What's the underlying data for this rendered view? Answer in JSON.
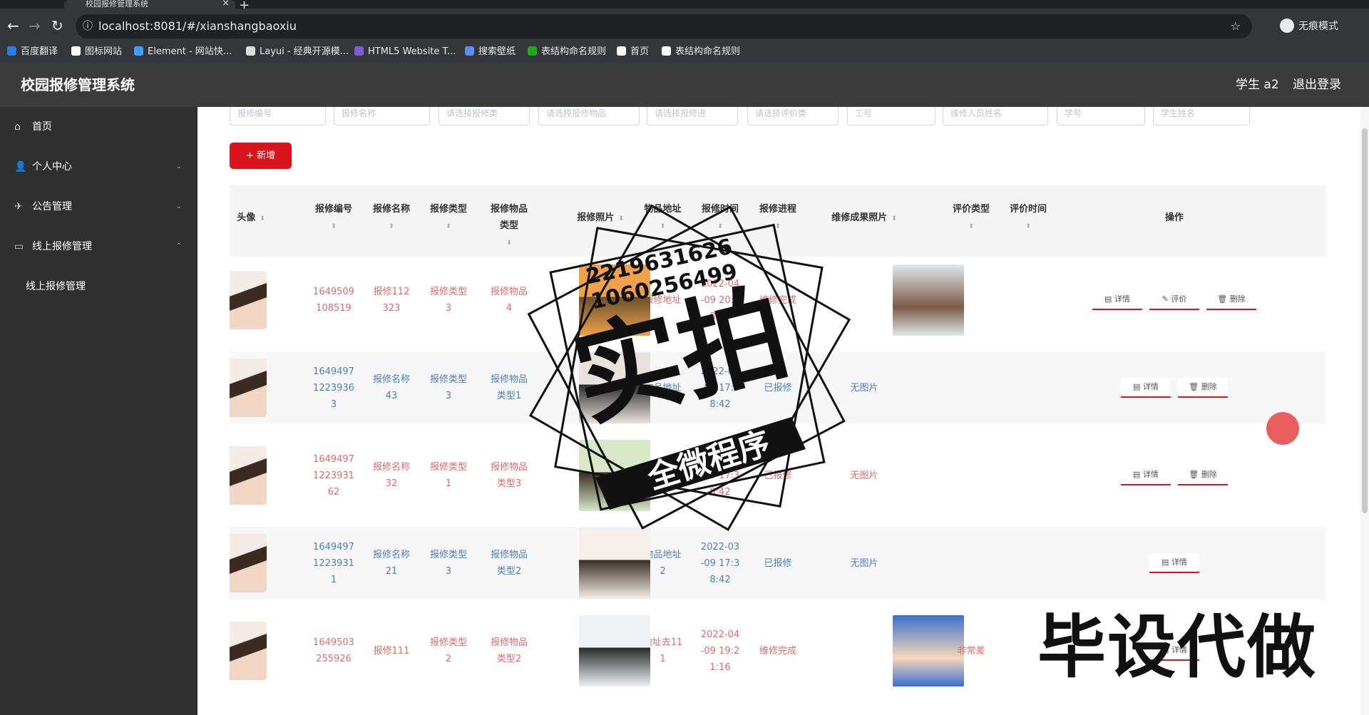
{
  "browser": {
    "tab_title": "校园报修管理系统",
    "tab_close": "×",
    "new_tab": "+",
    "back": "←",
    "forward": "→",
    "reload": "↻",
    "info_icon": "ⓘ",
    "url": "localhost:8081/#/xianshangbaoxiu",
    "star": "☆",
    "incognito_label": "无痕模式",
    "bookmarks": [
      {
        "label": "百度翻译",
        "color": "#2d7be5"
      },
      {
        "label": "图标网站",
        "color": "#ffffff"
      },
      {
        "label": "Element - 网站快...",
        "color": "#409eff"
      },
      {
        "label": "Layui - 经典开源模...",
        "color": "#dddddd"
      },
      {
        "label": "HTML5 Website T...",
        "color": "#7b5cd6"
      },
      {
        "label": "搜索壁纸",
        "color": "#5b8def"
      },
      {
        "label": "表结构命名规则",
        "color": "#1aad19"
      },
      {
        "label": "首页",
        "color": "#ffffff"
      },
      {
        "label": "表结构命名规则",
        "color": "#ffffff"
      }
    ]
  },
  "header": {
    "title": "校园报修管理系统",
    "user": "学生 a2",
    "logout": "退出登录"
  },
  "sidebar": {
    "items": [
      {
        "label": "首页",
        "icon": "⌂",
        "arrow": ""
      },
      {
        "label": "个人中心",
        "icon": "👤",
        "arrow": "⌄"
      },
      {
        "label": "公告管理",
        "icon": "✈",
        "arrow": "⌄"
      },
      {
        "label": "线上报修管理",
        "icon": "▭",
        "arrow": "⌃"
      }
    ],
    "subitem": "线上报修管理"
  },
  "search": {
    "fields": [
      "报修编号",
      "报修名称",
      "请选择报修类",
      "请选择报修物品",
      "请选择报修进",
      "请选择评价类",
      "工号",
      "维修人员姓名",
      "学号",
      "学生姓名"
    ]
  },
  "add_button": "+ 新增",
  "table": {
    "sort_glyph": "⬍",
    "columns": [
      {
        "l1": "头像",
        "l2": "",
        "sort_inline": true
      },
      {
        "l1": "报修编号",
        "l2": "",
        "sort_inline": false
      },
      {
        "l1": "报修名称",
        "l2": "",
        "sort_inline": false
      },
      {
        "l1": "报修类型",
        "l2": "",
        "sort_inline": false
      },
      {
        "l1": "报修物品",
        "l2": "类型",
        "sort_inline": false
      },
      {
        "l1": "报修照片",
        "l2": "",
        "sort_inline": true
      },
      {
        "l1": "物品地址",
        "l2": "",
        "sort_inline": false
      },
      {
        "l1": "报修时间",
        "l2": "",
        "sort_inline": false
      },
      {
        "l1": "报修进程",
        "l2": "",
        "sort_inline": false
      },
      {
        "l1": "维修成果照片",
        "l2": "",
        "sort_inline": true
      },
      {
        "l1": "评价类型",
        "l2": "",
        "sort_inline": false
      },
      {
        "l1": "评价时间",
        "l2": "",
        "sort_inline": false
      },
      {
        "l1": "操作",
        "l2": "",
        "sort_inline": false
      }
    ],
    "rows": [
      {
        "tone": "red",
        "id": [
          "1649509",
          "108519"
        ],
        "name": [
          "报修112",
          "323"
        ],
        "type": [
          "报修类型",
          "3"
        ],
        "item": [
          "报修物品",
          "4"
        ],
        "addr": [
          "报修地址",
          ""
        ],
        "time": [
          "2022-04",
          "-09 20:5",
          "8:44"
        ],
        "status": "维修完成",
        "result": "photo",
        "eval_type": "",
        "eval_time": "",
        "ops": [
          "详情",
          "评价",
          "删除"
        ],
        "photo_colors": [
          "#f0a14b",
          "#6b4f2c"
        ],
        "result_colors": [
          "#dfe9ee",
          "#7d5a48"
        ]
      },
      {
        "tone": "blue",
        "id": [
          "1649497",
          "1223936",
          "3"
        ],
        "name": [
          "报修名称",
          "43"
        ],
        "type": [
          "报修类型",
          "3"
        ],
        "item": [
          "报修物品",
          "类型1"
        ],
        "addr": [
          "物品地址",
          ""
        ],
        "time": [
          "2022-03",
          "-09 17:3",
          "8:42"
        ],
        "status": "已报修",
        "result": "无图片",
        "eval_type": "",
        "eval_time": "",
        "ops": [
          "详情",
          "删除"
        ],
        "photo_colors": [
          "#e9e3dd",
          "#2c2c2c"
        ],
        "result_colors": null
      },
      {
        "tone": "red",
        "id": [
          "1649497",
          "1223931",
          "62"
        ],
        "name": [
          "报修名称",
          "32"
        ],
        "type": [
          "报修类型",
          "1"
        ],
        "item": [
          "报修物品",
          "类型3"
        ],
        "addr": [
          "物品地址",
          "3"
        ],
        "time": [
          "2022-03",
          "-09 17:3",
          "8:42"
        ],
        "status": "已报修",
        "result": "无图片",
        "eval_type": "",
        "eval_time": "",
        "ops": [
          "详情",
          "删除"
        ],
        "photo_colors": [
          "#d9e8c8",
          "#3a2e24"
        ],
        "result_colors": null
      },
      {
        "tone": "blue",
        "id": [
          "1649497",
          "1223931",
          "1"
        ],
        "name": [
          "报修名称",
          "21"
        ],
        "type": [
          "报修类型",
          "3"
        ],
        "item": [
          "报修物品",
          "类型2"
        ],
        "addr": [
          "物品地址",
          "2"
        ],
        "time": [
          "2022-03",
          "-09 17:3",
          "8:42"
        ],
        "status": "已报修",
        "result": "无图片",
        "eval_type": "",
        "eval_time": "",
        "ops": [
          "详情"
        ],
        "photo_colors": [
          "#f4efe8",
          "#3b2f29"
        ],
        "result_colors": null
      },
      {
        "tone": "red",
        "id": [
          "1649503",
          "255926"
        ],
        "name": [
          "报修111",
          ""
        ],
        "type": [
          "报修类型",
          "2"
        ],
        "item": [
          "报修物品",
          "类型2"
        ],
        "addr": [
          "地址去11",
          "1"
        ],
        "time": [
          "2022-04",
          "-09 19:2",
          "1:16"
        ],
        "status": "维修完成",
        "result": "photo",
        "eval_type": "非常差",
        "eval_time": "",
        "ops": [
          "详情"
        ],
        "photo_colors": [
          "#eef1f3",
          "#2b2b2b"
        ],
        "result_colors": [
          "#3d6fd0",
          "#f5d8b8"
        ]
      }
    ]
  },
  "watermark": {
    "phone1": "2219631626",
    "phone2": "1060256499",
    "big": "实拍",
    "banner": "全微程序",
    "bottom": "毕设代做"
  }
}
